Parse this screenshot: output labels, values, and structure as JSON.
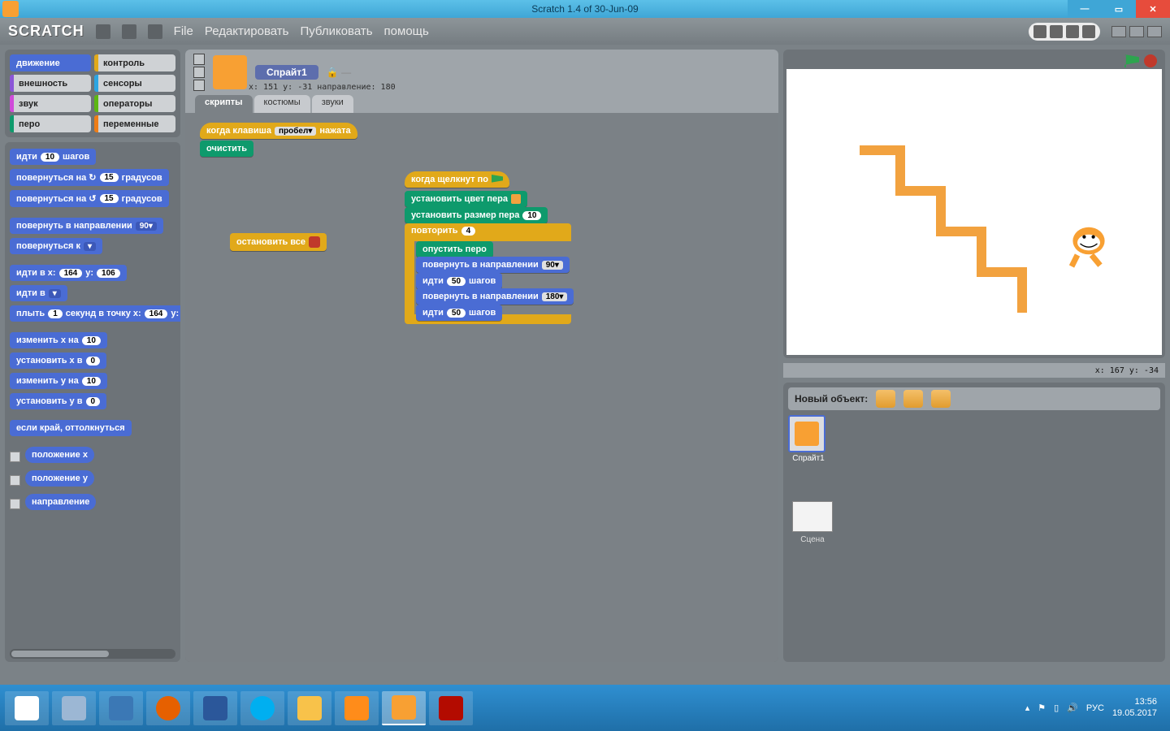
{
  "window": {
    "title": "Scratch 1.4 of 30-Jun-09"
  },
  "menu": {
    "logo": "SCRATCH",
    "items": [
      "File",
      "Редактировать",
      "Публиковать",
      "помощь"
    ]
  },
  "categories": [
    {
      "label": "движение",
      "color": "#4a6cd4",
      "selected": true
    },
    {
      "label": "контроль",
      "color": "#e1a91a",
      "selected": false
    },
    {
      "label": "внешность",
      "color": "#8a55d7",
      "selected": false
    },
    {
      "label": "сенсоры",
      "color": "#2ca5e2",
      "selected": false
    },
    {
      "label": "звук",
      "color": "#cf4ad9",
      "selected": false
    },
    {
      "label": "операторы",
      "color": "#5cb712",
      "selected": false
    },
    {
      "label": "перо",
      "color": "#0e9a6c",
      "selected": false
    },
    {
      "label": "переменные",
      "color": "#ee7d16",
      "selected": false
    }
  ],
  "motion_blocks": {
    "b0": {
      "pre": "идти",
      "arg": "10",
      "post": "шагов"
    },
    "b1": {
      "pre": "повернуться на ↻",
      "arg": "15",
      "post": "градусов"
    },
    "b2": {
      "pre": "повернуться на ↺",
      "arg": "15",
      "post": "градусов"
    },
    "b3": {
      "pre": "повернуть в направлении",
      "arg": "90▾"
    },
    "b4": {
      "pre": "повернуться к",
      "arg": " ▾"
    },
    "b5": {
      "pre": "идти в x:",
      "a1": "164",
      "mid": "y:",
      "a2": "106"
    },
    "b6": {
      "pre": "идти в",
      "arg": " ▾"
    },
    "b7": {
      "pre": "плыть",
      "a1": "1",
      "mid": "секунд в точку x:",
      "a2": "164",
      "mid2": "y:",
      "a3": ""
    },
    "b8": {
      "pre": "изменить x на",
      "arg": "10"
    },
    "b9": {
      "pre": "установить x в",
      "arg": "0"
    },
    "b10": {
      "pre": "изменить y на",
      "arg": "10"
    },
    "b11": {
      "pre": "установить y в",
      "arg": "0"
    },
    "b12": {
      "pre": "если край, оттолкнуться"
    },
    "r0": "положение x",
    "r1": "положение y",
    "r2": "направление"
  },
  "sprite": {
    "name": "Спрайт1",
    "coords": "x: 151  y: -31  направление: 180"
  },
  "tabs": [
    "скрипты",
    "костюмы",
    "звуки"
  ],
  "scripts": {
    "s1_hat": {
      "pre": "когда клавиша",
      "sel": "пробел▾",
      "post": "нажата"
    },
    "s1_b": "очистить",
    "stopall": "остановить все",
    "s2_hat": "когда щелкнут по",
    "s2_pen_color": "установить цвет пера",
    "s2_pen_size": {
      "pre": "установить размер пера",
      "arg": "10"
    },
    "s2_repeat": {
      "pre": "повторить",
      "arg": "4"
    },
    "s2_pendown": "опустить перо",
    "s2_dir1": {
      "pre": "повернуть в направлении",
      "arg": "90▾"
    },
    "s2_move1": {
      "pre": "идти",
      "arg": "50",
      "post": "шагов"
    },
    "s2_dir2": {
      "pre": "повернуть в направлении",
      "arg": "180▾"
    },
    "s2_move2": {
      "pre": "идти",
      "arg": "50",
      "post": "шагов"
    }
  },
  "stage": {
    "mouse": "x: 167   y: -34",
    "new_object": "Новый объект:",
    "stage_label": "Сцена",
    "sprite1": "Спрайт1"
  },
  "taskbar": {
    "lang": "РУС",
    "time": "13:56",
    "date": "19.05.2017"
  }
}
